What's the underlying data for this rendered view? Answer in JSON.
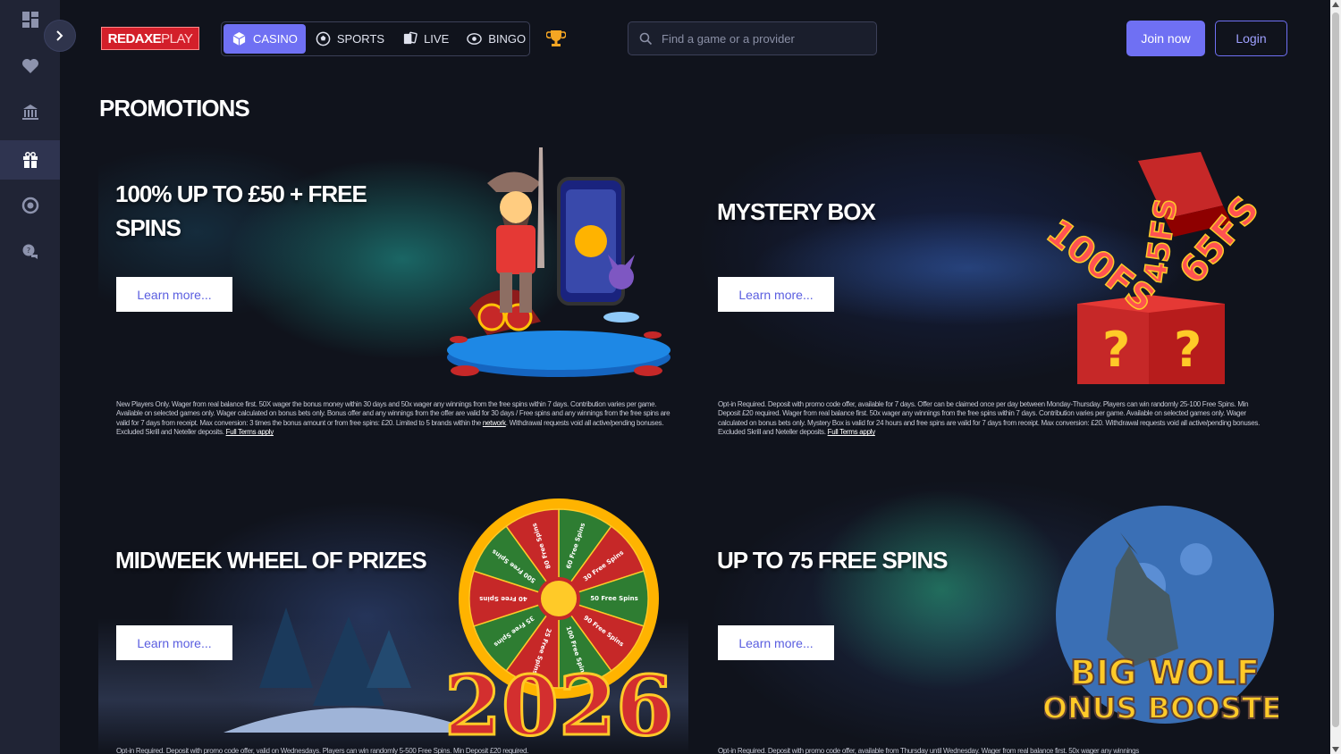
{
  "brand": {
    "logo_part1": "REDAXE",
    "logo_part2": "PLAY"
  },
  "rail": {
    "items": [
      {
        "icon": "dashboard-icon"
      },
      {
        "icon": "heart-icon"
      },
      {
        "icon": "casino-building-icon"
      },
      {
        "icon": "gift-icon",
        "active": true
      },
      {
        "icon": "chip-icon"
      },
      {
        "icon": "support-chat-icon"
      }
    ]
  },
  "nav": {
    "tabs": [
      {
        "label": "CASINO",
        "icon": "cube-icon",
        "active": true
      },
      {
        "label": "SPORTS",
        "icon": "football-icon"
      },
      {
        "label": "LIVE",
        "icon": "live-cards-icon"
      },
      {
        "label": "BINGO",
        "icon": "bingo-ball-icon"
      }
    ]
  },
  "search": {
    "placeholder": "Find a game or a provider",
    "value": ""
  },
  "header": {
    "join_label": "Join now",
    "login_label": "Login"
  },
  "page_title": "PROMOTIONS",
  "promos": [
    {
      "title_line1": "100% UP TO £50 + FREE",
      "title_line2": "SPINS",
      "button": "Learn more...",
      "terms": "New Players Only. Wager from real balance first. 50X wager the bonus money within 30 days and 50x wager any winnings from the free spins within 7 days. Contribution varies per game. Available on selected games only. Wager calculated on bonus bets only. Bonus offer and any winnings from the offer are valid for 30 days / Free spins and any winnings from the free spins are valid for 7 days from receipt. Max conversion: 3 times the bonus amount or from free spins: £20. Limited to 5 brands within the",
      "terms_link1": "network",
      "terms_mid": ". Withdrawal requests void all active/pending bonuses. Excluded Skrill and Neteller deposits.",
      "terms_link2": "Full Terms apply"
    },
    {
      "title_line1": "MYSTERY BOX",
      "title_line2": "",
      "button": "Learn more...",
      "terms": "Opt-in Required. Deposit with promo code offer, available for 7 days. Offer can be claimed once per day between Monday-Thursday. Players can win randomly 25-100 Free Spins. Min Deposit £20 required. Wager from real balance first. 50x wager any winnings from the free spins within 7 days. Contribution varies per game. Available on selected games only. Wager calculated on bonus bets only. Mystery Box is valid for 24 hours and free spins are valid for 7 days from receipt. Max conversion: £20. Withdrawal requests void all active/pending bonuses. Excluded Skrill and Neteller deposits.",
      "terms_link1": "",
      "terms_mid": "",
      "terms_link2": "Full Terms apply"
    },
    {
      "title_line1": "MIDWEEK WHEEL OF PRIZES",
      "title_line2": "",
      "button": "Learn more...",
      "terms": "Opt-in Required. Deposit with promo code offer, valid on Wednesdays. Players can win randomly 5-500 Free Spins. Min Deposit £20 required.",
      "terms_link1": "",
      "terms_mid": "",
      "terms_link2": ""
    },
    {
      "title_line1": "UP TO 75 FREE SPINS",
      "title_line2": "",
      "button": "Learn more...",
      "terms": "Opt-in Required. Deposit with promo code offer, available from Thursday until Wednesday. Wager from real balance first. 50x wager any winnings",
      "terms_link1": "",
      "terms_mid": "",
      "terms_link2": ""
    }
  ],
  "art": {
    "mystery_labels": [
      "100FS",
      "45FS",
      "65FS"
    ],
    "mystery_box_marks": [
      "?",
      "?"
    ],
    "wheel_year": "2026",
    "wheel_segments": [
      "60 Free Spins",
      "30 Free Spins",
      "50 Free Spins",
      "90 Free Spins",
      "100 Free Spins",
      "25 Free Spins",
      "35 Free Spins",
      "40 Free Spins",
      "500 Free Spins",
      "80 Free Spins"
    ],
    "wolf_title_line1": "BIG WOLF",
    "wolf_title_line2": "BONUS BOOSTER"
  }
}
